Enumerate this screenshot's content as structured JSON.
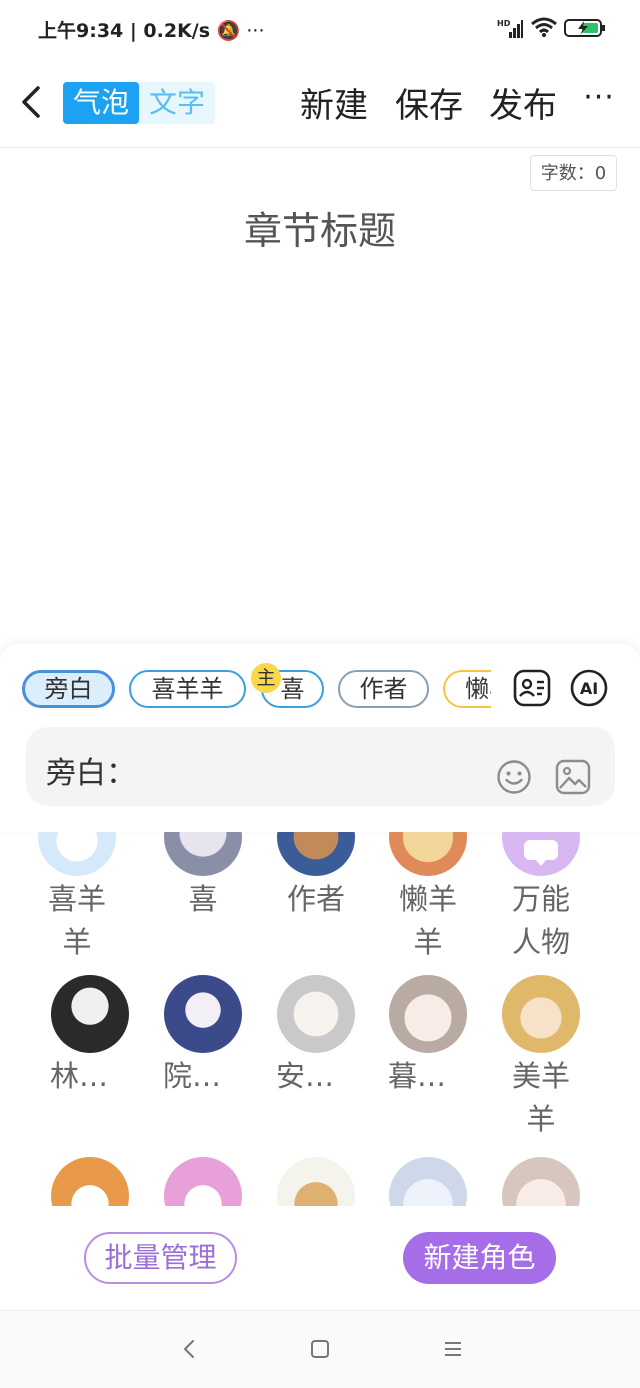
{
  "status_bar": {
    "time_text": "上午9:34 | 0.2K/s ",
    "extra": "🔕 ···"
  },
  "header": {
    "mode_bubble": "气泡",
    "mode_text": "文字",
    "new_label": "新建",
    "save_label": "保存",
    "publish_label": "发布",
    "more_label": "···"
  },
  "editor": {
    "word_count": "字数：0",
    "chapter_title": "章节标题"
  },
  "roles_bar": {
    "chips": [
      "旁白",
      "喜羊羊",
      "喜",
      "作者",
      "懒羊羊"
    ],
    "main_badge": "主"
  },
  "input": {
    "prefix": "旁白："
  },
  "characters": [
    {
      "name": "喜羊羊"
    },
    {
      "name": "喜"
    },
    {
      "name": "作者"
    },
    {
      "name": "懒羊羊"
    },
    {
      "name": "万能人物"
    },
    {
      "name": "林（第…"
    },
    {
      "name": "院长（喜…"
    },
    {
      "name": "安（喜…"
    },
    {
      "name": "暮雪（喜…"
    },
    {
      "name": "美羊羊"
    }
  ],
  "actions": {
    "batch_manage": "批量管理",
    "new_role": "新建角色"
  },
  "colors": {
    "accent_blue": "#1da1f2",
    "accent_purple": "#a56ee8",
    "badge_yellow": "#f8d84a"
  }
}
